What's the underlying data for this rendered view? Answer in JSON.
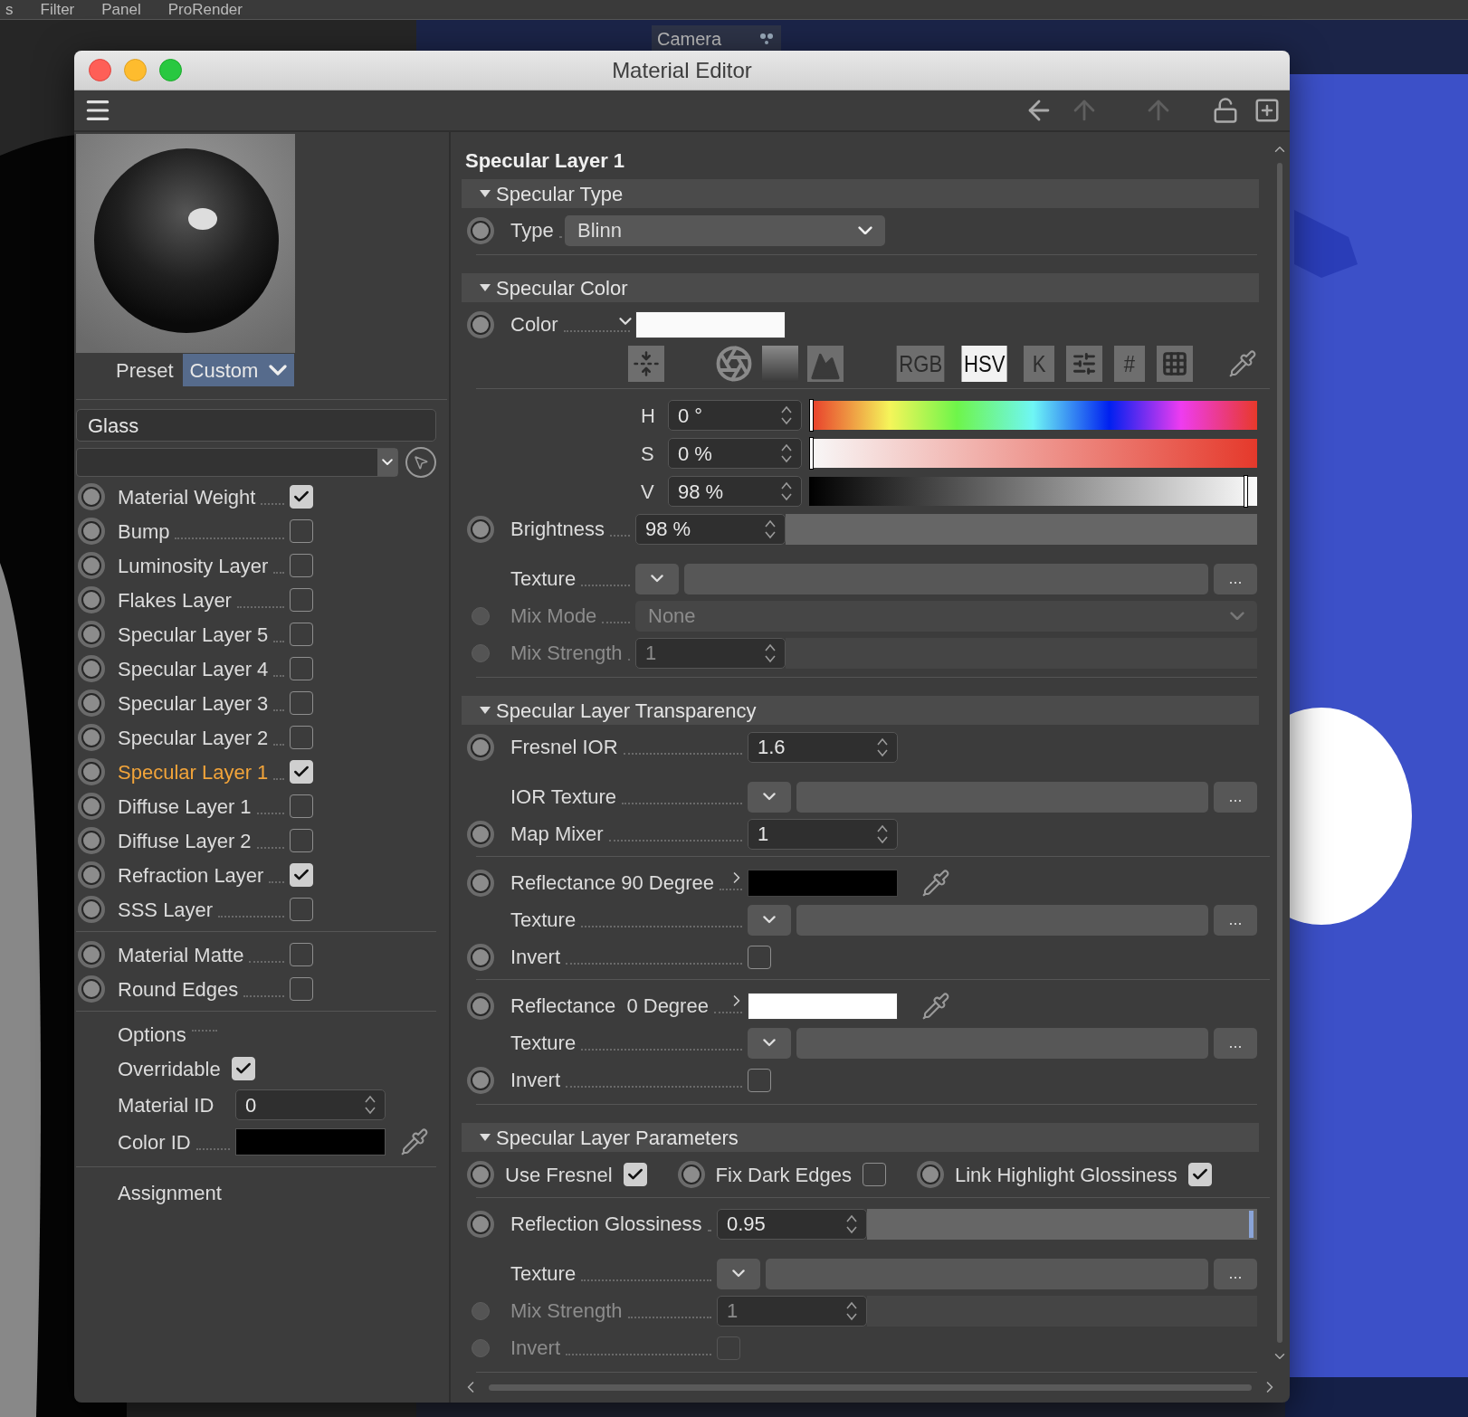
{
  "menu_bar": [
    {
      "label": "s"
    },
    {
      "label": "Filter"
    },
    {
      "label": "Panel"
    },
    {
      "label": "ProRender"
    }
  ],
  "viewport": {
    "camera_label": "Camera"
  },
  "window": {
    "title": "Material Editor"
  },
  "preview": {
    "preset_label": "Preset",
    "preset_value": "Custom"
  },
  "material_name": "Glass",
  "channels": [
    {
      "label": "Material Weight",
      "checked": true,
      "selected": false
    },
    {
      "label": "Bump",
      "checked": false,
      "selected": false
    },
    {
      "label": "Luminosity Layer",
      "checked": false,
      "selected": false
    },
    {
      "label": "Flakes Layer",
      "checked": false,
      "selected": false
    },
    {
      "label": "Specular Layer 5",
      "checked": false,
      "selected": false
    },
    {
      "label": "Specular Layer 4",
      "checked": false,
      "selected": false
    },
    {
      "label": "Specular Layer 3",
      "checked": false,
      "selected": false
    },
    {
      "label": "Specular Layer 2",
      "checked": false,
      "selected": false
    },
    {
      "label": "Specular Layer 1",
      "checked": true,
      "selected": true
    },
    {
      "label": "Diffuse Layer 1",
      "checked": false,
      "selected": false
    },
    {
      "label": "Diffuse Layer 2",
      "checked": false,
      "selected": false
    },
    {
      "label": "Refraction Layer",
      "checked": true,
      "selected": false
    },
    {
      "label": "SSS Layer",
      "checked": false,
      "selected": false
    }
  ],
  "extra_channels": [
    {
      "label": "Material Matte",
      "checked": false
    },
    {
      "label": "Round Edges",
      "checked": false
    }
  ],
  "options": {
    "label": "Options",
    "overridable_label": "Overridable",
    "overridable": true,
    "material_id_label": "Material ID",
    "material_id": "0",
    "color_id": {
      "label": "Color ID",
      "color": "#000000"
    }
  },
  "assignment": "Assignment",
  "panel": {
    "title": "Specular Layer 1",
    "sections": [
      {
        "title": "Specular Type",
        "groups": [
          [
            {
              "kind": "menu",
              "label": "Type",
              "value": "Blinn",
              "disabled": false
            }
          ]
        ]
      },
      {
        "title": "Specular Color",
        "groups": [
          [
            {
              "kind": "color",
              "label": "Color",
              "color": "#fafafa",
              "expanded": true,
              "disabled": false
            },
            {
              "kind": "picker",
              "modes": [
                {
                  "label": "RGB",
                  "selected": false
                },
                {
                  "label": "HSV",
                  "selected": true
                },
                {
                  "label": "K",
                  "selected": false
                },
                {
                  "label": "#",
                  "selected": false
                }
              ]
            }
          ],
          [
            {
              "kind": "hue",
              "label": "H",
              "value": "0 °",
              "level": 0
            },
            {
              "kind": "saturation",
              "label": "S",
              "value": "0 %",
              "level": 0
            },
            {
              "kind": "lightness",
              "label": "V",
              "value": "98 %",
              "level": 0.98
            },
            {
              "kind": "slider",
              "label": "Brightness",
              "value": "98 %",
              "disabled": false
            },
            {
              "kind": "texture",
              "label": "Texture",
              "button": "...",
              "disabled": false
            },
            {
              "kind": "dropdown",
              "label": "Mix Mode",
              "value": "None",
              "disabled": true
            },
            {
              "kind": "slider",
              "label": "Mix Strength",
              "value": "1",
              "disabled": true
            }
          ]
        ]
      },
      {
        "title": "Specular Layer Transparency",
        "groups": [
          [
            {
              "kind": "number",
              "label": "Fresnel IOR",
              "value": "1.6",
              "disabled": false
            },
            {
              "kind": "texture",
              "label": "IOR Texture",
              "button": "...",
              "disabled": false
            },
            {
              "kind": "number",
              "label": "Map Mixer",
              "value": "1",
              "disabled": false
            }
          ],
          [
            {
              "kind": "color",
              "label": "Reflectance 90 Degree",
              "color": "#000000",
              "expanded": false,
              "disabled": false
            },
            {
              "kind": "texture",
              "label": "Texture",
              "button": "...",
              "disabled": false
            },
            {
              "kind": "checkbox",
              "label": "Invert",
              "checked": false,
              "disabled": false
            }
          ],
          [
            {
              "kind": "color",
              "label": "Reflectance  0 Degree",
              "color": "#ffffff",
              "expanded": false,
              "disabled": false
            },
            {
              "kind": "texture",
              "label": "Texture",
              "button": "...",
              "disabled": false
            },
            {
              "kind": "checkbox",
              "label": "Invert",
              "checked": false,
              "disabled": false
            }
          ]
        ]
      },
      {
        "title": "Specular Layer Parameters",
        "groups": [
          [
            {
              "kind": "checks",
              "items": [
                {
                  "label": "Use Fresnel",
                  "checked": true
                },
                {
                  "label": "Fix Dark Edges",
                  "checked": false
                },
                {
                  "label": "Link Highlight Glossiness",
                  "checked": true
                }
              ]
            }
          ],
          [
            {
              "kind": "slider",
              "label": "Reflection Glossiness",
              "value": "0.95",
              "level": 0.99,
              "disabled": false
            },
            {
              "kind": "texture",
              "label": "Texture",
              "button": "...",
              "disabled": false
            },
            {
              "kind": "slider",
              "label": "Mix Strength",
              "value": "1",
              "disabled": true
            },
            {
              "kind": "checkbox",
              "label": "Invert",
              "checked": false,
              "disabled": true
            }
          ]
        ]
      }
    ]
  }
}
